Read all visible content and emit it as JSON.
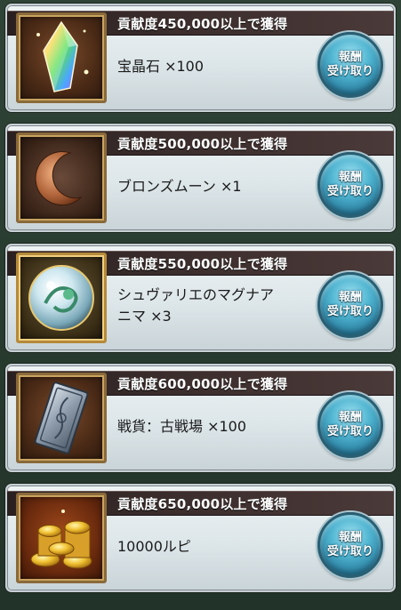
{
  "rewards": [
    {
      "requirement": "貢献度450,000以上で獲得",
      "item": "宝晶石 ×100",
      "icon": "crystal-icon",
      "button": {
        "line1": "報酬",
        "line2": "受け取り"
      }
    },
    {
      "requirement": "貢献度500,000以上で獲得",
      "item": "ブロンズムーン ×1",
      "icon": "bronze-moon-icon",
      "button": {
        "line1": "報酬",
        "line2": "受け取り"
      }
    },
    {
      "requirement": "貢献度550,000以上で獲得",
      "item_line1": "シュヴァリエのマグナア",
      "item_line2": "ニマ ×3",
      "icon": "magna-anima-orb-icon",
      "button": {
        "line1": "報酬",
        "line2": "受け取り"
      }
    },
    {
      "requirement": "貢献度600,000以上で獲得",
      "item": "戦貨：古戦場 ×100",
      "icon": "battle-token-icon",
      "button": {
        "line1": "報酬",
        "line2": "受け取り"
      }
    },
    {
      "requirement": "貢献度650,000以上で獲得",
      "item": "10000ルピ",
      "icon": "rupie-coins-icon",
      "button": {
        "line1": "報酬",
        "line2": "受け取り"
      }
    }
  ],
  "colors": {
    "header_bg": "#3c2e2d",
    "button_blue": "#4fb4d0",
    "card_bg": "#e4ecee"
  }
}
